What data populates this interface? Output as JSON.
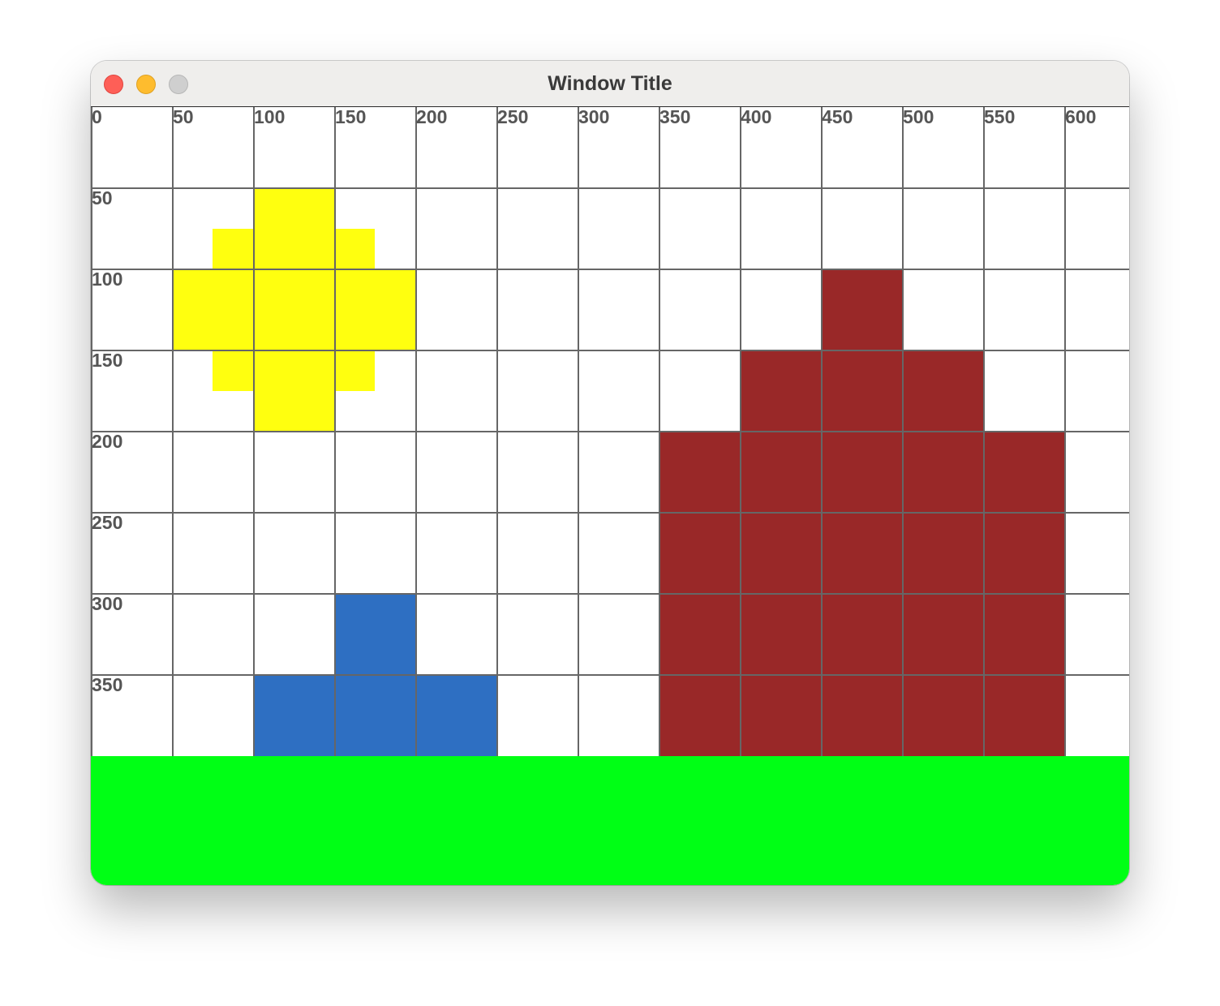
{
  "window": {
    "title": "Window Title"
  },
  "traffic_lights": [
    "close",
    "minimize",
    "zoom"
  ],
  "canvas": {
    "x_ticks": [
      "0",
      "50",
      "100",
      "150",
      "200",
      "250",
      "300",
      "350",
      "400",
      "450",
      "500",
      "550",
      "600"
    ],
    "y_ticks": [
      "50",
      "100",
      "150",
      "200",
      "250",
      "300",
      "350"
    ],
    "grid_step": 50,
    "colors": {
      "sun": "#ffff0f",
      "water": "#2e6fc2",
      "mountain": "#992828",
      "grass": "#00ff15",
      "grid": "#666666",
      "label": "#555555"
    },
    "shapes": [
      {
        "name": "sun-block",
        "color": "sun",
        "cells": [
          [
            100,
            50,
            50,
            50
          ],
          [
            75,
            75,
            100,
            25
          ],
          [
            50,
            100,
            150,
            50
          ],
          [
            75,
            150,
            100,
            25
          ],
          [
            100,
            175,
            50,
            25
          ]
        ]
      },
      {
        "name": "water-block",
        "color": "water",
        "cells": [
          [
            150,
            300,
            50,
            50
          ],
          [
            100,
            350,
            150,
            50
          ]
        ]
      },
      {
        "name": "mountain-block",
        "color": "mountain",
        "cells": [
          [
            450,
            100,
            50,
            50
          ],
          [
            400,
            150,
            150,
            50
          ],
          [
            350,
            200,
            250,
            200
          ]
        ]
      },
      {
        "name": "grass-band",
        "color": "grass",
        "cells": [
          [
            0,
            400,
            640,
            80
          ]
        ]
      }
    ]
  }
}
